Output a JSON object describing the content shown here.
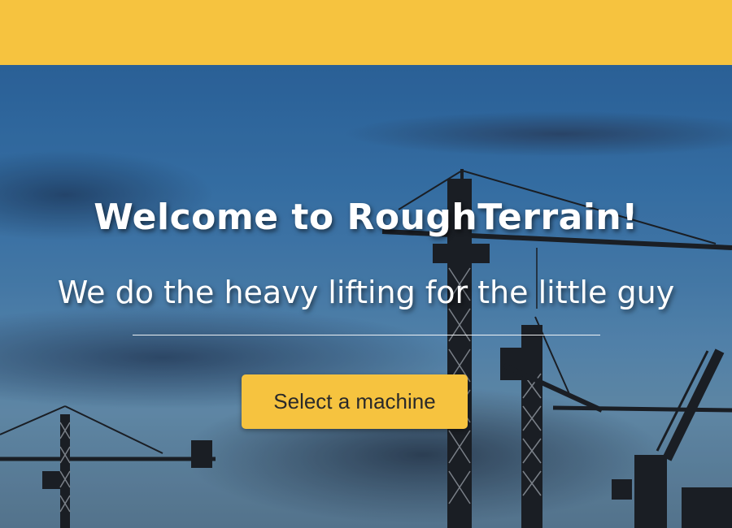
{
  "hero": {
    "headline": "Welcome to RoughTerrain!",
    "tagline": "We do the heavy lifting for the little guy",
    "cta_label": "Select a machine",
    "background_description_icon": "construction-cranes-dusk"
  },
  "colors": {
    "brand_yellow": "#f6c33f",
    "text_white": "#ffffff",
    "button_text": "#2a2a2a"
  }
}
